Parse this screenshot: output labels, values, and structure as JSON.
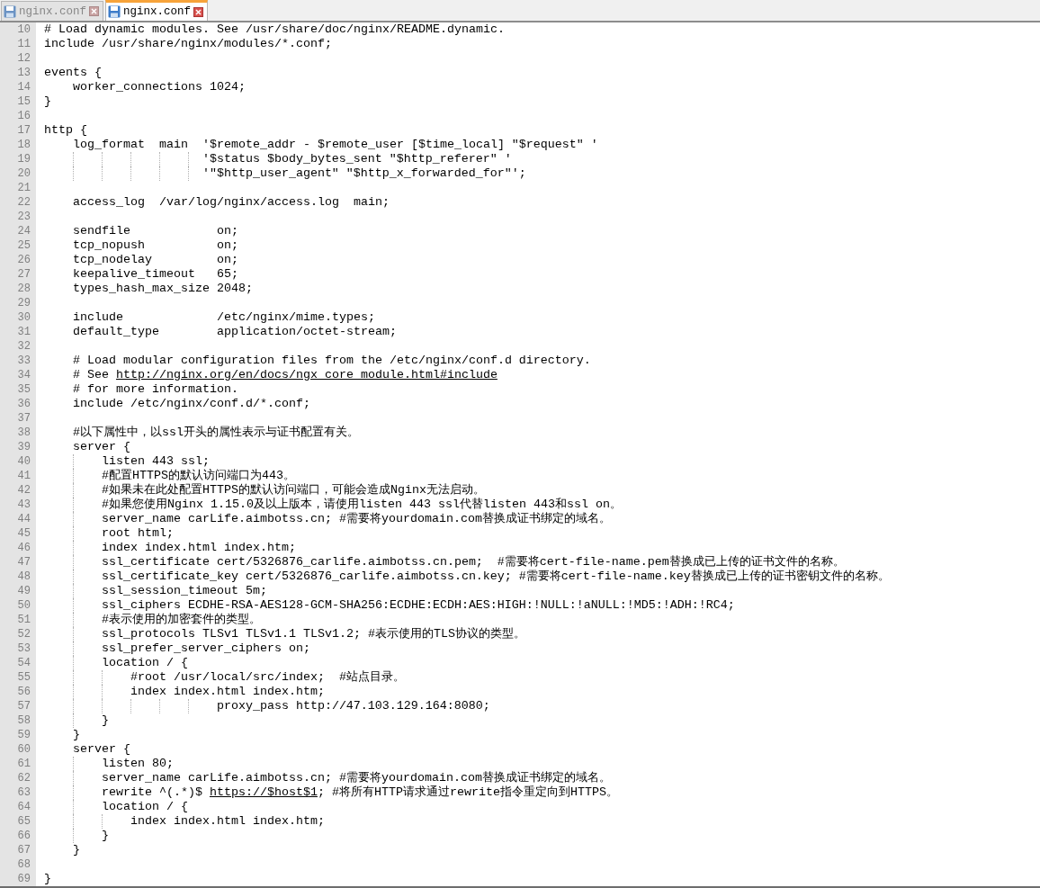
{
  "tabs": [
    {
      "label": "nginx.conf",
      "selected": false
    },
    {
      "label": "nginx.conf",
      "selected": true
    }
  ],
  "lines": [
    {
      "n": "10",
      "text": "# Load dynamic modules. See /usr/share/doc/nginx/README.dynamic."
    },
    {
      "n": "11",
      "text": "include /usr/share/nginx/modules/*.conf;"
    },
    {
      "n": "12"
    },
    {
      "n": "13",
      "text": "events {"
    },
    {
      "n": "14",
      "text": "    worker_connections 1024;"
    },
    {
      "n": "15",
      "text": "}"
    },
    {
      "n": "16"
    },
    {
      "n": "17",
      "text": "http {"
    },
    {
      "n": "18",
      "text": "    log_format  main  '$remote_addr - $remote_user [$time_local] \"$request\" '"
    },
    {
      "n": "19",
      "text": "                      '$status $body_bytes_sent \"$http_referer\" '"
    },
    {
      "n": "20",
      "text": "                      '\"$http_user_agent\" \"$http_x_forwarded_for\"';"
    },
    {
      "n": "21"
    },
    {
      "n": "22",
      "text": "    access_log  /var/log/nginx/access.log  main;"
    },
    {
      "n": "23"
    },
    {
      "n": "24",
      "text": "    sendfile            on;"
    },
    {
      "n": "25",
      "text": "    tcp_nopush          on;"
    },
    {
      "n": "26",
      "text": "    tcp_nodelay         on;"
    },
    {
      "n": "27",
      "text": "    keepalive_timeout   65;"
    },
    {
      "n": "28",
      "text": "    types_hash_max_size 2048;"
    },
    {
      "n": "29"
    },
    {
      "n": "30",
      "text": "    include             /etc/nginx/mime.types;"
    },
    {
      "n": "31",
      "text": "    default_type        application/octet-stream;"
    },
    {
      "n": "32"
    },
    {
      "n": "33",
      "text": "    # Load modular configuration files from the /etc/nginx/conf.d directory."
    },
    {
      "n": "34",
      "text": "    # See ",
      "link": "http://nginx.org/en/docs/ngx_core_module.html#include"
    },
    {
      "n": "35",
      "text": "    # for more information."
    },
    {
      "n": "36",
      "text": "    include /etc/nginx/conf.d/*.conf;"
    },
    {
      "n": "37"
    },
    {
      "n": "38",
      "text": "    #以下属性中，以ssl开头的属性表示与证书配置有关。"
    },
    {
      "n": "39",
      "text": "    server {"
    },
    {
      "n": "40",
      "text": "        listen 443 ssl;"
    },
    {
      "n": "41",
      "text": "        #配置HTTPS的默认访问端口为443。"
    },
    {
      "n": "42",
      "text": "        #如果未在此处配置HTTPS的默认访问端口，可能会造成Nginx无法启动。"
    },
    {
      "n": "43",
      "text": "        #如果您使用Nginx 1.15.0及以上版本，请使用listen 443 ssl代替listen 443和ssl on。"
    },
    {
      "n": "44",
      "text": "        server_name carLife.aimbotss.cn; #需要将yourdomain.com替换成证书绑定的域名。"
    },
    {
      "n": "45",
      "text": "        root html;"
    },
    {
      "n": "46",
      "text": "        index index.html index.htm;"
    },
    {
      "n": "47",
      "text": "        ssl_certificate cert/5326876_carlife.aimbotss.cn.pem;  #需要将cert-file-name.pem替换成已上传的证书文件的名称。"
    },
    {
      "n": "48",
      "text": "        ssl_certificate_key cert/5326876_carlife.aimbotss.cn.key; #需要将cert-file-name.key替换成已上传的证书密钥文件的名称。"
    },
    {
      "n": "49",
      "text": "        ssl_session_timeout 5m;"
    },
    {
      "n": "50",
      "text": "        ssl_ciphers ECDHE-RSA-AES128-GCM-SHA256:ECDHE:ECDH:AES:HIGH:!NULL:!aNULL:!MD5:!ADH:!RC4;"
    },
    {
      "n": "51",
      "text": "        #表示使用的加密套件的类型。"
    },
    {
      "n": "52",
      "text": "        ssl_protocols TLSv1 TLSv1.1 TLSv1.2; #表示使用的TLS协议的类型。"
    },
    {
      "n": "53",
      "text": "        ssl_prefer_server_ciphers on;"
    },
    {
      "n": "54",
      "text": "        location / {"
    },
    {
      "n": "55",
      "text": "            #root /usr/local/src/index;  #站点目录。"
    },
    {
      "n": "56",
      "text": "            index index.html index.htm;"
    },
    {
      "n": "57",
      "text": "                        proxy_pass http://47.103.129.164:8080;"
    },
    {
      "n": "58",
      "text": "        }"
    },
    {
      "n": "59",
      "text": "    }"
    },
    {
      "n": "60",
      "text": "    server {"
    },
    {
      "n": "61",
      "text": "        listen 80;"
    },
    {
      "n": "62",
      "text": "        server_name carLife.aimbotss.cn; #需要将yourdomain.com替换成证书绑定的域名。"
    },
    {
      "n": "63",
      "text": "        rewrite ^(.*)$ ",
      "link": "https://$host$1",
      "after": "; #将所有HTTP请求通过rewrite指令重定向到HTTPS。"
    },
    {
      "n": "64",
      "text": "        location / {"
    },
    {
      "n": "65",
      "text": "            index index.html index.htm;"
    },
    {
      "n": "66",
      "text": "        }"
    },
    {
      "n": "67",
      "text": "    }"
    },
    {
      "n": "68"
    },
    {
      "n": "69",
      "text": "}"
    }
  ]
}
